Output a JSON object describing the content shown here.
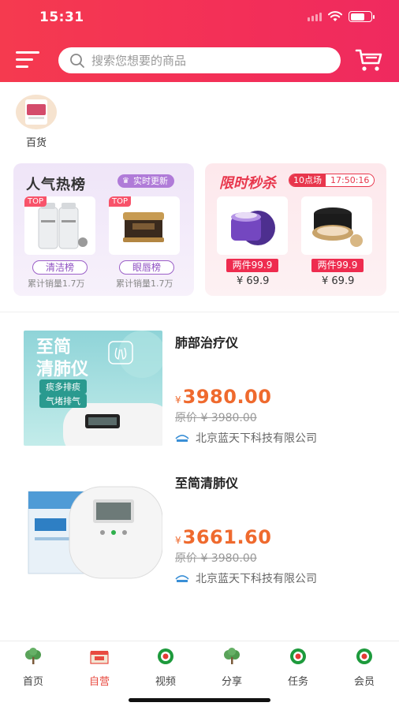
{
  "status_bar": {
    "time": "15:31"
  },
  "search": {
    "placeholder": "搜索您想要的商品"
  },
  "categories": [
    {
      "label": "百货"
    }
  ],
  "hot_rank": {
    "title": "人气热榜",
    "badge": "实时更新",
    "items": [
      {
        "tag": "TOP",
        "rank_label": "清洁榜",
        "sales": "累计销量1.7万"
      },
      {
        "tag": "TOP",
        "rank_label": "眼唇榜",
        "sales": "累计销量1.7万"
      }
    ]
  },
  "flash_sale": {
    "title": "限时秒杀",
    "session": "10点场",
    "countdown": "17:50:16",
    "items": [
      {
        "promo": "两件99.9",
        "price": "¥ 69.9"
      },
      {
        "promo": "两件99.9",
        "price": "¥ 69.9"
      }
    ]
  },
  "products": [
    {
      "name": "肺部治疗仪",
      "currency": "¥",
      "price": "3980.00",
      "original_price": "原价 ¥ 3980.00",
      "shop": "北京蓝天下科技有限公司",
      "image_text": {
        "line1": "至简",
        "line2": "清肺仪",
        "pill1": "痰多排痰",
        "pill2": "气堵排气"
      }
    },
    {
      "name": "至简清肺仪",
      "currency": "¥",
      "price": "3661.60",
      "original_price": "原价 ¥ 3980.00",
      "shop": "北京蓝天下科技有限公司"
    }
  ],
  "tabbar": [
    {
      "label": "首页",
      "icon": "tree-icon"
    },
    {
      "label": "自营",
      "icon": "shop-icon",
      "active": true
    },
    {
      "label": "视频",
      "icon": "care-badge-icon"
    },
    {
      "label": "分享",
      "icon": "tree-icon"
    },
    {
      "label": "任务",
      "icon": "care-badge-icon"
    },
    {
      "label": "会员",
      "icon": "care-badge-icon"
    }
  ],
  "colors": {
    "header": "#f33a55",
    "accent": "#e8364c",
    "price": "#ef6a2e",
    "purple": "#9b5fc7",
    "active_tab": "#e84a3f"
  }
}
